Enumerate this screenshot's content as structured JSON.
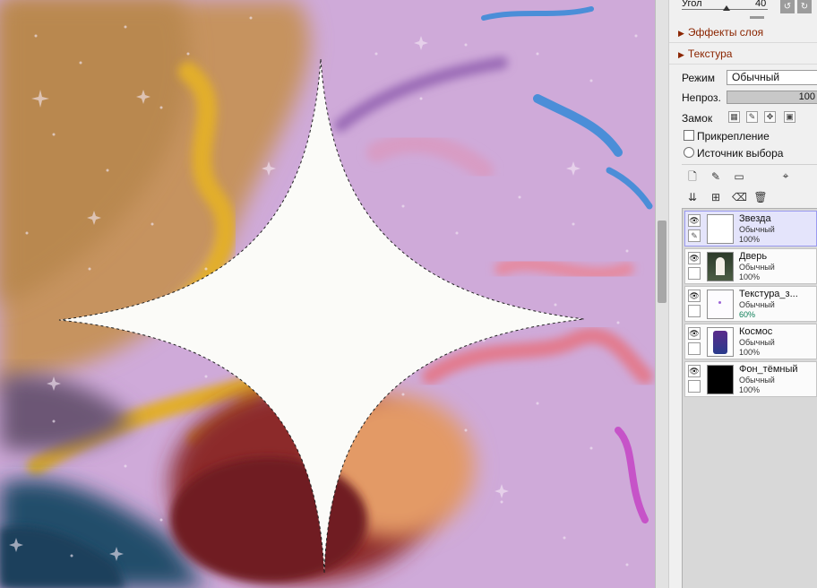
{
  "panel": {
    "angle_label": "Угол",
    "angle_value": "40",
    "layer_effects": "Эффекты слоя",
    "texture": "Текстура",
    "mode_label": "Режим",
    "mode_value": "Обычный",
    "opacity_label": "Непроз.",
    "opacity_value": "100",
    "lock_label": "Замок",
    "clipping_label": "Прикрепление",
    "selection_source_label": "Источник выбора"
  },
  "layers": [
    {
      "name": "Звезда",
      "mode": "Обычный",
      "opacity": "100%",
      "selected": true
    },
    {
      "name": "Дверь",
      "mode": "Обычный",
      "opacity": "100%",
      "selected": false
    },
    {
      "name": "Текстура_з...",
      "mode": "Обычный",
      "opacity": "60%",
      "selected": false
    },
    {
      "name": "Космос",
      "mode": "Обычный",
      "opacity": "100%",
      "selected": false
    },
    {
      "name": "Фон_тёмный",
      "mode": "Обычный",
      "opacity": "100%",
      "selected": false
    }
  ],
  "icons": {
    "layer_effects_arrow": "triangle-right-icon",
    "texture_arrow": "triangle-right-icon",
    "visibility": "eye-icon",
    "new_layer": "new-layer-icon",
    "delete_layer": "trash-icon"
  },
  "colors": {
    "accent": "#8b2500",
    "selected_layer_bg": "#e4e4fb",
    "opacity_60_text": "#0b7d56"
  }
}
